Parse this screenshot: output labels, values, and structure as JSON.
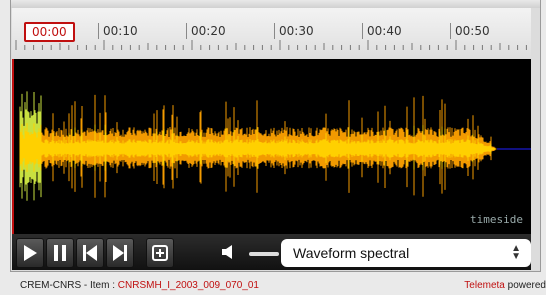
{
  "ruler": {
    "current_time": "00:00",
    "ticks": [
      "00:10",
      "00:20",
      "00:30",
      "00:40",
      "00:50"
    ]
  },
  "waveform": {
    "logo": "timeside",
    "colors": {
      "background": "#000000",
      "wave_outer": "#f29a00",
      "wave_inner": "#ffd000",
      "wave_attack": "#c8e040",
      "tail": "#2020ff",
      "playhead": "#c01010"
    }
  },
  "controls": {
    "icons": [
      "play-icon",
      "pause-icon",
      "skip-back-icon",
      "skip-forward-icon",
      "add-marker-icon",
      "volume-icon"
    ],
    "view_select": {
      "selected": "Waveform spectral",
      "arrow": "▲▼"
    }
  },
  "footer": {
    "prefix": "CREM-CNRS - Item : ",
    "item_code": "CNRSMH_I_2003_009_070_01",
    "brand": "Telemeta",
    "powered": " powered"
  }
}
